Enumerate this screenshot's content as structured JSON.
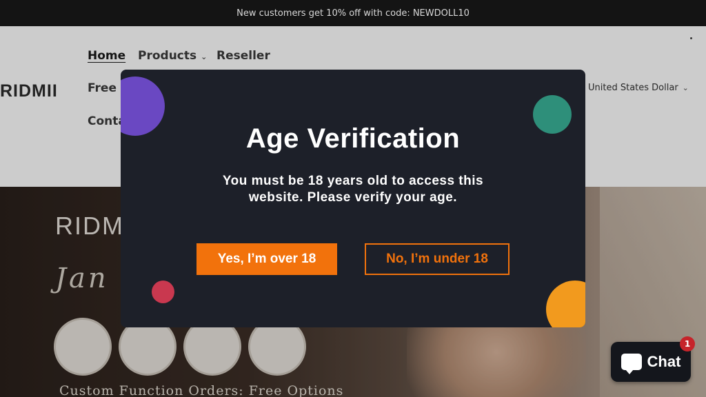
{
  "announcement": "New customers get 10% off with code: NEWDOLL10",
  "header": {
    "logo": "RIDMII",
    "nav": {
      "home": "Home",
      "products": "Products",
      "reseller": "Reseller",
      "free_d": "Free D",
      "contact": "Conta"
    },
    "currency": "United States Dollar"
  },
  "hero": {
    "logo": "RIDMI",
    "script": "Jan",
    "caption": "Custom Function Orders: Free Options"
  },
  "modal": {
    "title": "Age Verification",
    "message": "You must be 18 years old to access this website. Please verify your age.",
    "yes_label": "Yes, I’m over 18",
    "no_label": "No, I’m under 18"
  },
  "chat": {
    "label": "Chat",
    "badge": "1"
  },
  "colors": {
    "accent": "#f2720c",
    "modal_bg": "#1d2029",
    "bubble_purple": "#6a48c2",
    "bubble_teal": "#2e8f7a",
    "bubble_red": "#c9384f",
    "bubble_orange": "#f29a1e"
  }
}
